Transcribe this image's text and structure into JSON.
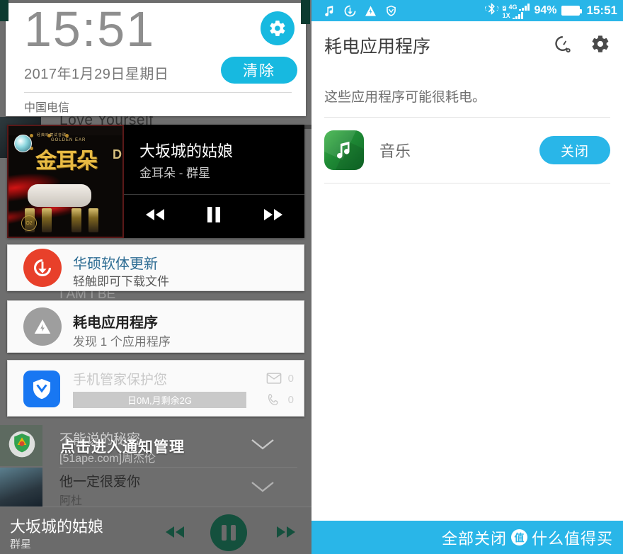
{
  "left_panel": {
    "clock": {
      "time": "15:51",
      "date": "2017年1月29日星期日",
      "carrier": "中国电信",
      "clear_label": "清除"
    },
    "music_notification": {
      "title": "大坂城的姑娘",
      "artist": "金耳朵 - 群星",
      "album_art_text": "金耳朵",
      "album_art_sub": "GOLDEN EAR",
      "album_art_top": "经典珍藏试音碟"
    },
    "notifications": [
      {
        "id": "asus-update",
        "title": "华硕软体更新",
        "subtitle": "轻触即可下载文件",
        "icon": "download-circle-icon",
        "icon_color": "#e8402a"
      },
      {
        "id": "power-hungry-apps",
        "title": "耗电应用程序",
        "subtitle": "发现 1 个应用程序",
        "icon": "power-bolt-icon",
        "icon_color": "#9e9e9e"
      }
    ],
    "qq_card": {
      "title": "手机管家保护您",
      "chip": "日0M,月剩余2G",
      "mail_count": "0",
      "call_count": "0",
      "icon": "qq-shield-icon",
      "icon_color": "#1877f2"
    },
    "ghost_rows": [
      {
        "title": "不能说的秘密",
        "subtitle": "[51ape.com]周杰伦"
      },
      {
        "title": "他一定很爱你",
        "subtitle": "阿杜"
      }
    ],
    "ghost_background_text": "Love Yourself",
    "hint_text": "点击进入通知管理",
    "mini_player": {
      "title": "大坂城的姑娘",
      "artist": "群星",
      "play_state": "pause"
    }
  },
  "right_panel": {
    "statusbar": {
      "left_icons": [
        "music-note-icon",
        "download-circle-icon",
        "power-bolt-icon",
        "shield-icon"
      ],
      "bluetooth_icon": "bluetooth-icon",
      "network_primary": "4G",
      "network_primary_badge": "2",
      "network_secondary": "1X",
      "battery_percent": "94%",
      "clock": "15:51"
    },
    "header": {
      "title": "耗电应用程序",
      "actions": [
        "speedometer-wrench-icon",
        "gear-icon"
      ]
    },
    "description": "这些应用程序可能很耗电。",
    "apps": [
      {
        "name": "音乐",
        "button_label": "关闭",
        "icon": "music-note-icon",
        "icon_color": "#2b9b3e"
      }
    ],
    "bottom_bar": {
      "label": "全部关闭"
    },
    "watermark": {
      "badge": "值",
      "text": "什么值得买"
    }
  },
  "colors": {
    "accent_blue": "#29b6e8",
    "cyan": "#17b9e0",
    "dark_green": "#14503d",
    "edge_green": "#0c3b30",
    "panel_gray": "#6e6e6e"
  }
}
